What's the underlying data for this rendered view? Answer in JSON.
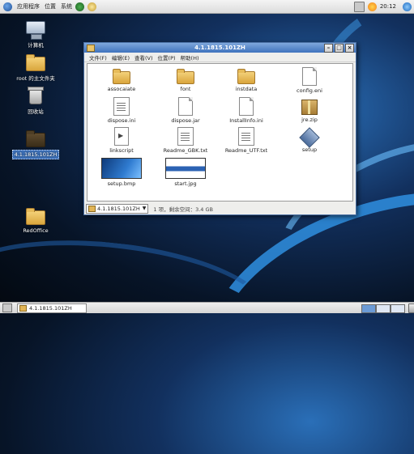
{
  "top_panel": {
    "menus": [
      "应用程序",
      "位置",
      "系统"
    ],
    "clock": "20:12"
  },
  "desktop": {
    "icons": [
      {
        "label": "计算机",
        "icon": "computer-icon"
      },
      {
        "label": "root 的主文件夹",
        "icon": "home-folder-icon"
      },
      {
        "label": "回收站",
        "icon": "trash-icon"
      },
      {
        "label": "4.1.1815.101ZH",
        "icon": "folder-icon",
        "selected": true
      },
      {
        "label": "RedOffice",
        "icon": "folder-icon"
      }
    ]
  },
  "window": {
    "title": "4.1.1815.101ZH",
    "menus": [
      "文件(F)",
      "编辑(E)",
      "查看(V)",
      "位置(P)",
      "帮助(H)"
    ],
    "files": [
      {
        "name": "assocaiate",
        "kind": "folder"
      },
      {
        "name": "font",
        "kind": "folder"
      },
      {
        "name": "instdata",
        "kind": "folder"
      },
      {
        "name": "config.eni",
        "kind": "doc"
      },
      {
        "name": "dispose.ini",
        "kind": "textdoc"
      },
      {
        "name": "dispose.jar",
        "kind": "doc"
      },
      {
        "name": "InstallInfo.ini",
        "kind": "doc"
      },
      {
        "name": "jre.zip",
        "kind": "archive"
      },
      {
        "name": "linkscript",
        "kind": "script"
      },
      {
        "name": "Readme_GBK.txt",
        "kind": "textdoc"
      },
      {
        "name": "Readme_UTF.txt",
        "kind": "textdoc"
      },
      {
        "name": "setup",
        "kind": "setup"
      },
      {
        "name": "setup.bmp",
        "kind": "thumb-bmp"
      },
      {
        "name": "start.jpg",
        "kind": "thumb-jpg"
      }
    ],
    "location": "4.1.1815.101ZH",
    "status": "1 项，剩余空间：3.4 GB"
  },
  "taskbar": {
    "task_label": "4.1.1815.101ZH"
  }
}
